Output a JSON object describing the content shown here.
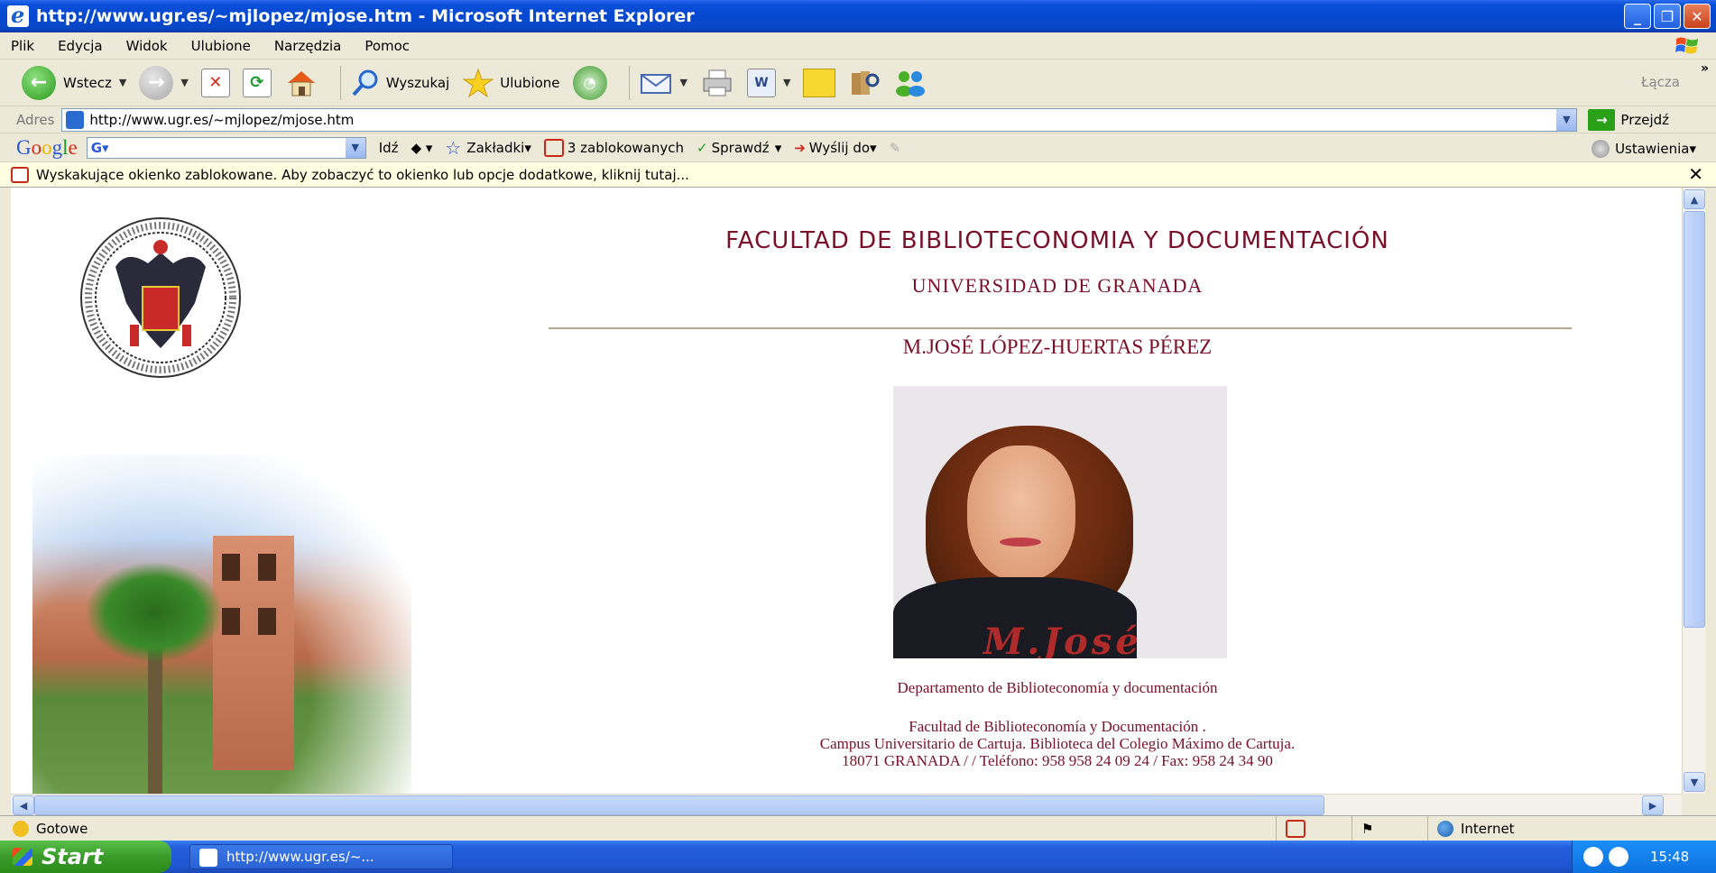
{
  "window": {
    "title": "http://www.ugr.es/~mjlopez/mjose.htm - Microsoft Internet Explorer",
    "btn_minimize": "_",
    "btn_maximize": "❐",
    "btn_close": "✕"
  },
  "menu": {
    "items": [
      "Plik",
      "Edycja",
      "Widok",
      "Ulubione",
      "Narzędzia",
      "Pomoc"
    ]
  },
  "toolbar": {
    "back_label": "Wstecz",
    "search_label": "Wyszukaj",
    "favorites_label": "Ulubione",
    "links_label": "Łącza",
    "more": "»"
  },
  "address": {
    "label": "Adres",
    "url": "http://www.ugr.es/~mjlopez/mjose.htm",
    "go_label": "Przejdź"
  },
  "googlebar": {
    "go_label": "Idź",
    "bookmarks_label": "Zakładki",
    "blocked_label": "3 zablokowanych",
    "check_label": "Sprawdź",
    "send_label": "Wyślij do",
    "settings_label": "Ustawienia"
  },
  "infobar": {
    "message": "Wyskakujące okienko zablokowane. Aby zobaczyć to okienko lub opcje dodatkowe, kliknij tutaj...",
    "close": "✕"
  },
  "page": {
    "faculty_title": "FACULTAD DE BIBLIOTECONOMIA Y DOCUMENTACIÓN",
    "university": "UNIVERSIDAD DE GRANADA",
    "person_name": "M.JOSÉ LÓPEZ-HUERTAS PÉREZ",
    "photo_signature": "M.José",
    "department": "Departamento de Biblioteconomía y documentación",
    "address_line1": "Facultad de Biblioteconomía y Documentación .",
    "address_line2": "Campus Universitario de Cartuja. Biblioteca del Colegio Máximo de Cartuja.",
    "address_line3": "18071 GRANADA / / Teléfono: 958 958 24 09 24 / Fax: 958 24 34 90"
  },
  "statusbar": {
    "status": "Gotowe",
    "zone": "Internet"
  },
  "taskbar": {
    "start_label": "Start",
    "task_label": "http://www.ugr.es/~...",
    "clock": "15:48"
  }
}
